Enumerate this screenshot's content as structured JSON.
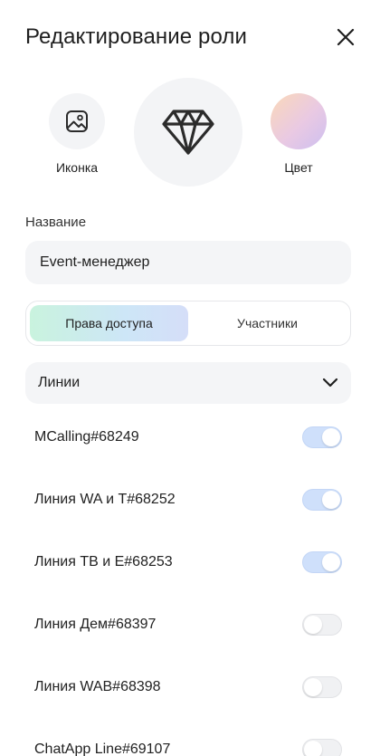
{
  "header": {
    "title": "Редактирование роли"
  },
  "picker": {
    "icon_label": "Иконка",
    "color_label": "Цвет",
    "selected_icon": "diamond-icon",
    "color_gradient": [
      "#fbd9b8",
      "#e9c9e3",
      "#cdbff0"
    ]
  },
  "name_field": {
    "label": "Название",
    "value": "Event-менеджер"
  },
  "tabs": [
    {
      "label": "Права доступа",
      "active": true
    },
    {
      "label": "Участники",
      "active": false
    }
  ],
  "dropdown": {
    "label": "Линии"
  },
  "lines": [
    {
      "name": "MCalling#68249",
      "enabled": true
    },
    {
      "name": "Линия WA и T#68252",
      "enabled": true
    },
    {
      "name": "Линия ТВ и Е#68253",
      "enabled": true
    },
    {
      "name": "Линия Дем#68397",
      "enabled": false
    },
    {
      "name": "Линия WAB#68398",
      "enabled": false
    },
    {
      "name": "ChatApp Line#69107",
      "enabled": false
    }
  ],
  "colors": {
    "toggle_on": "#cfe0fb",
    "toggle_off": "#f0f1f3",
    "field_bg": "#f4f5f7"
  }
}
